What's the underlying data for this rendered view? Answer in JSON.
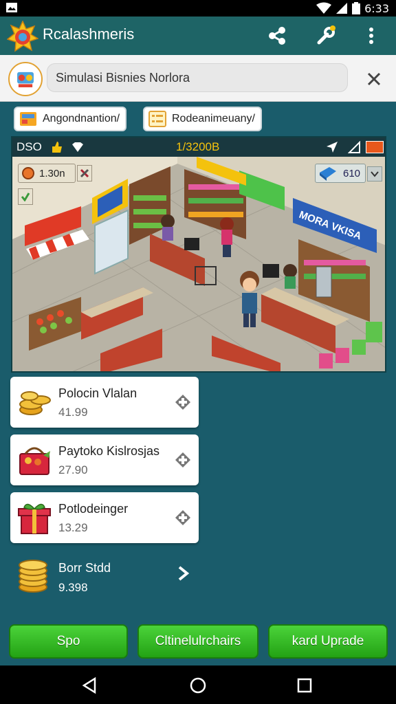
{
  "status_bar": {
    "time": "6:33"
  },
  "app": {
    "title": "Rcalashmeris",
    "search_value": "Simulasi Bisnies Norlora"
  },
  "chips": [
    {
      "label": "Angondnantion/"
    },
    {
      "label": "Rodeanimeuany/"
    }
  ],
  "game": {
    "hud_left": "DSO",
    "hud_center": "1/3200B",
    "money_label": "1.30n",
    "cash_box": "610",
    "signs": [
      "MORA VKISA"
    ]
  },
  "products": [
    {
      "name": "Polocin Vlalan",
      "price": "41.99",
      "thumb": "coins-icon"
    },
    {
      "name": "Paytoko Kislrosjas",
      "price": "27.90",
      "thumb": "basket-icon"
    },
    {
      "name": "Potlodeinger",
      "price": "13.29",
      "thumb": "gift-icon"
    }
  ],
  "coin_row": {
    "name": "Borr Stdd",
    "price": "9.398"
  },
  "buttons": {
    "spo": "Spo",
    "cltinelu": "Cltinelulrchairs",
    "upgrade": "kard Uprade"
  },
  "colors": {
    "teal_bg": "#1a5c6b",
    "toolbar": "#1e6466",
    "green_button": "#2fb820"
  }
}
